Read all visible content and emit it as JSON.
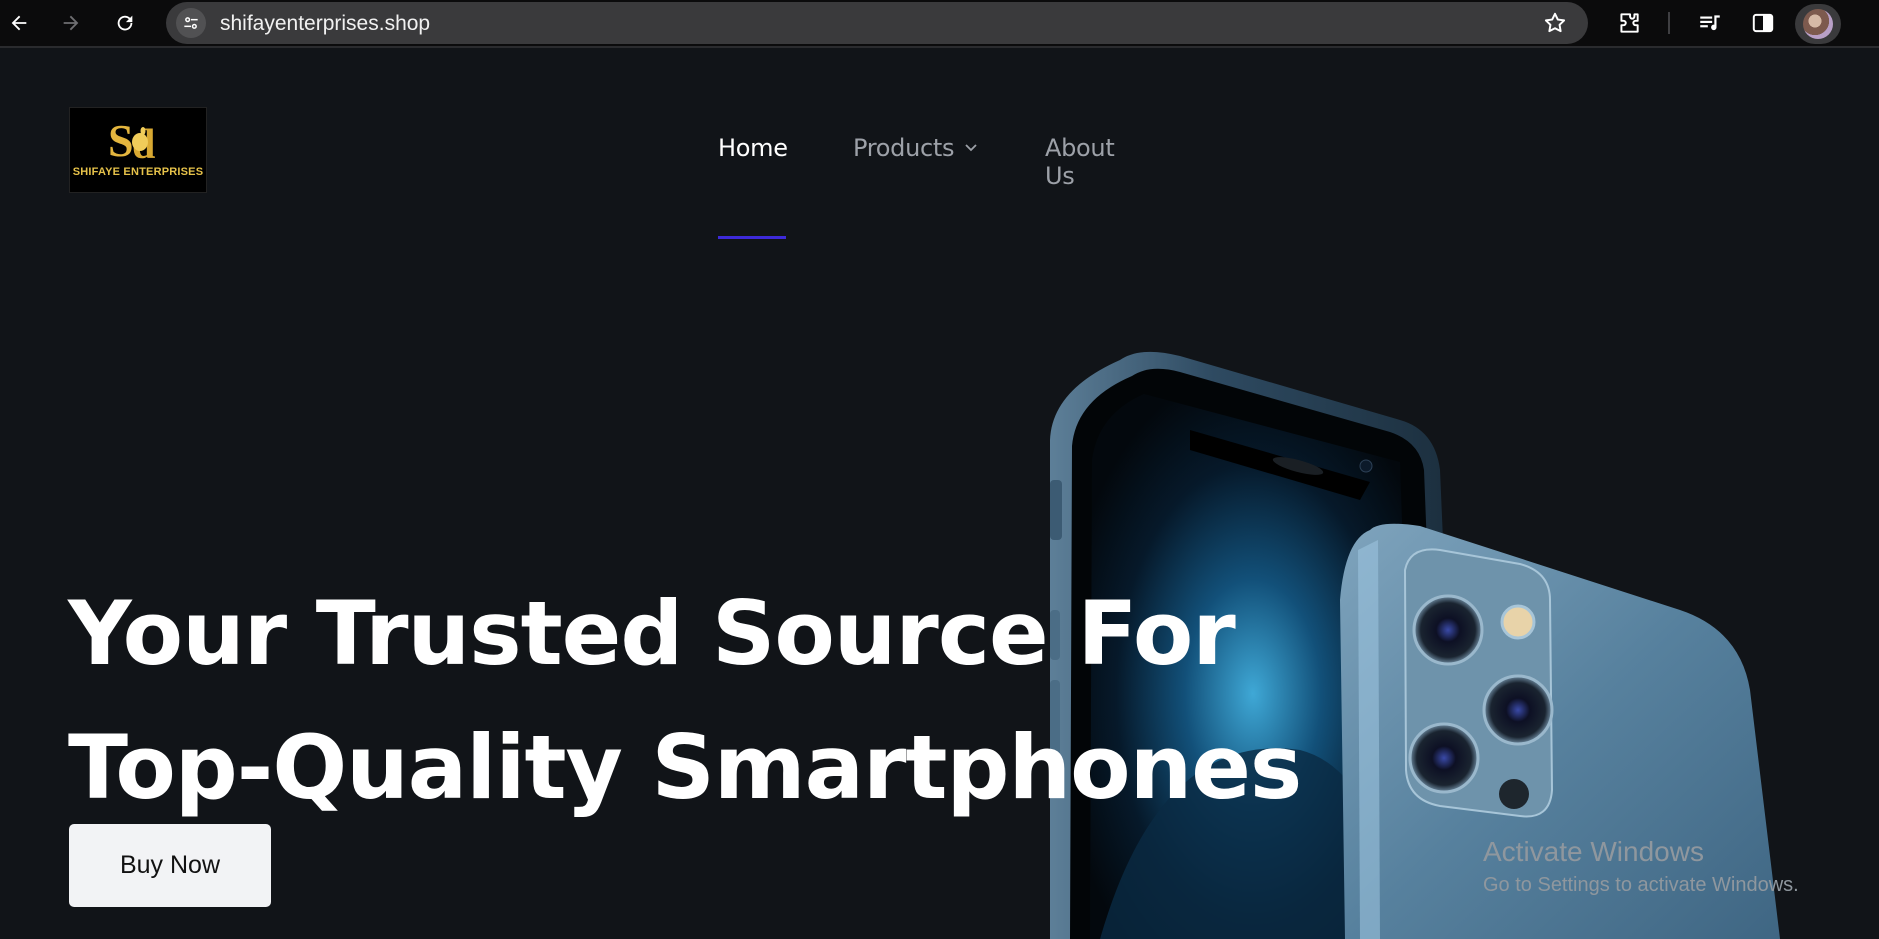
{
  "browser": {
    "url": "shifayenterprises.shop",
    "icons": [
      "back-icon",
      "forward-icon",
      "reload-icon",
      "site-info-icon",
      "bookmark-star-icon",
      "extensions-icon",
      "media-queue-icon",
      "side-panel-icon",
      "profile-avatar"
    ]
  },
  "site": {
    "logo_text": "SHIFAYE ENTERPRISES",
    "nav": {
      "home": "Home",
      "products": "Products",
      "about": "About Us",
      "active": "Home",
      "accent_color": "#3d2ad9"
    },
    "hero": {
      "line1": "Your Trusted Source For",
      "line2": "Top-Quality Smartphones",
      "cta": "Buy Now"
    }
  },
  "watermark": {
    "title": "Activate Windows",
    "subtitle": "Go to Settings to activate Windows."
  }
}
